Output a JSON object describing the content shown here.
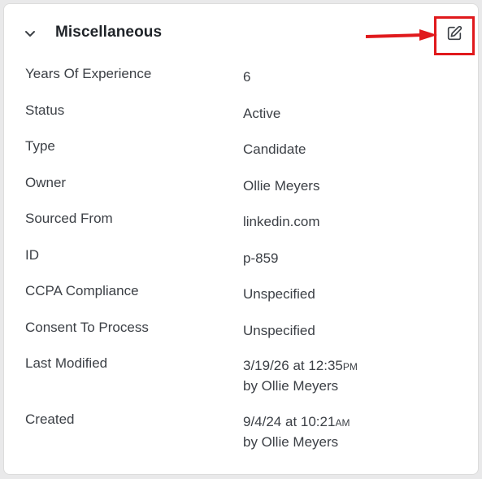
{
  "section": {
    "title": "Miscellaneous",
    "collapse_icon": "chevron-down-icon",
    "edit_icon": "edit-pencil-square-icon"
  },
  "annotation": {
    "highlight_color": "#e0191c",
    "arrow_icon": "arrow-right-icon"
  },
  "fields": [
    {
      "label": "Years Of Experience",
      "value": "6"
    },
    {
      "label": "Status",
      "value": "Active"
    },
    {
      "label": "Type",
      "value": "Candidate"
    },
    {
      "label": "Owner",
      "value": "Ollie Meyers"
    },
    {
      "label": "Sourced From",
      "value": "linkedin.com"
    },
    {
      "label": "ID",
      "value": "p-859"
    },
    {
      "label": "CCPA Compliance",
      "value": "Unspecified"
    },
    {
      "label": "Consent To Process",
      "value": "Unspecified"
    }
  ],
  "last_modified": {
    "label": "Last Modified",
    "datetime": "3/19/26 at 12:35",
    "meridiem": "PM",
    "by": "by Ollie Meyers"
  },
  "created": {
    "label": "Created",
    "datetime": "9/4/24 at 10:21",
    "meridiem": "AM",
    "by": "by Ollie Meyers"
  }
}
